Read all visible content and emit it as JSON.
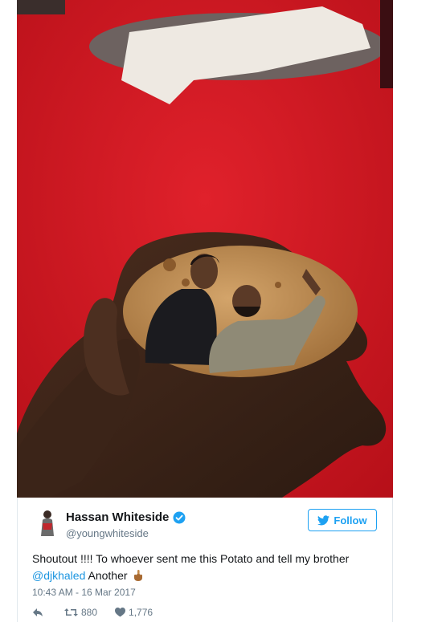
{
  "tweet": {
    "author_name": "Hassan Whiteside",
    "handle": "@youngwhiteside",
    "follow_label": "Follow",
    "text_before": "Shoutout !!!! To whoever sent me this Potato and tell my brother",
    "mention": "@djkhaled",
    "text_after": "Another",
    "timestamp": "10:43 AM - 16 Mar 2017",
    "retweets": "880",
    "likes": "1,776"
  },
  "icons": {
    "verified": "verified-badge-icon",
    "follow": "twitter-bird-icon",
    "reply": "reply-arrow-icon",
    "retweet": "retweet-icon",
    "like": "heart-icon",
    "emoji": "middle-finger-emoji"
  },
  "colors": {
    "twitter_blue": "#1da1f2",
    "mention": "#1b95e0",
    "secondary_text": "#657786",
    "carpet_red": "#c8141d"
  }
}
